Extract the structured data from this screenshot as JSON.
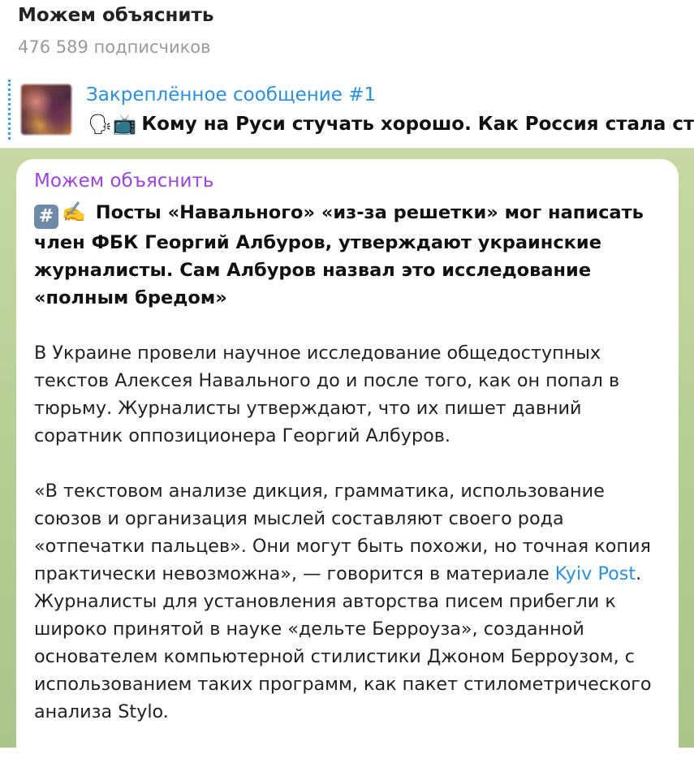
{
  "header": {
    "title": "Можем объяснить",
    "subscribers": "476 589 подписчиков"
  },
  "pinned": {
    "title": "Закреплённое сообщение #1",
    "emoji": "🗣📺",
    "text": "Кому на Руси стучать хорошо. Как Россия стала стран"
  },
  "message": {
    "author": "Можем объяснить",
    "icons": {
      "hash": "#",
      "writing_hand": "✍️"
    },
    "headline": "Посты «Навального» «из-за решетки» мог написать член ФБК Георгий Албуров, утверждают украинские журналисты. Сам Албуров назвал это исследование «полным бредом»",
    "paragraph1": "В Украине провели научное исследование общедоступных текстов Алексея Навального до и после того, как он попал в тюрьму. Журналисты утверждают, что их пишет давний соратник оппозиционера Георгий Албуров.",
    "paragraph2_before_link": "«В текстовом анализе дикция, грамматика, использование союзов и организация мыслей составляют своего рода «отпечатки пальцев». Они могут быть похожи, но точная копия практически невозможна», — говорится в материале ",
    "link_text": "Kyiv Post",
    "paragraph2_after_link": ". Журналисты для установления авторства писем прибегли к широко принятой в науке «дельте Берроуза», созданной основателем компьютерной стилистики Джоном Берроузом, с использованием таких программ, как пакет стилометрического анализа Stylo."
  },
  "colors": {
    "accent_link": "#2d8fd6",
    "author_name": "#9a45d8",
    "chat_background": "#b3cd92"
  }
}
